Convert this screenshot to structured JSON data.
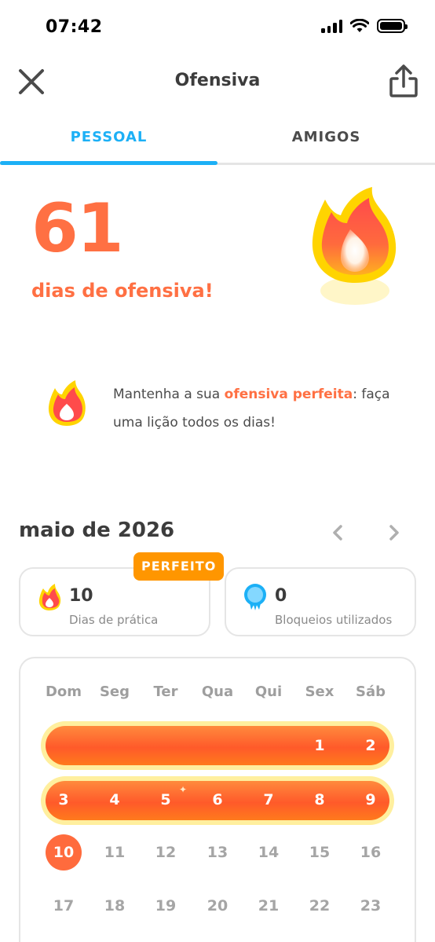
{
  "status_bar": {
    "time": "07:42"
  },
  "header": {
    "title": "Ofensiva",
    "close_icon": "close-icon",
    "share_icon": "share-icon"
  },
  "tabs": [
    {
      "label": "PESSOAL",
      "active": true
    },
    {
      "label": "AMIGOS",
      "active": false
    }
  ],
  "streak": {
    "days": "61",
    "caption": "dias de ofensiva!"
  },
  "tip": {
    "text_before": "Mantenha a sua ",
    "highlight": "ofensiva perfeita",
    "text_after": ": faça uma lição todos os dias!"
  },
  "month": {
    "title": "maio de 2026"
  },
  "stats": {
    "badge": "PERFEITO",
    "practice": {
      "value": "10",
      "label": "Dias de prática",
      "icon": "flame-icon"
    },
    "freezes": {
      "value": "0",
      "label": "Bloqueios utilizados",
      "icon": "streak-freeze-icon"
    }
  },
  "calendar": {
    "weekdays": [
      "Dom",
      "Seg",
      "Ter",
      "Qua",
      "Qui",
      "Sex",
      "Sáb"
    ],
    "week1": [
      "1",
      "2"
    ],
    "week2": [
      "3",
      "4",
      "5",
      "6",
      "7",
      "8",
      "9"
    ],
    "today": "10",
    "week3_rest": [
      "11",
      "12",
      "13",
      "14",
      "15",
      "16"
    ],
    "week4": [
      "17",
      "18",
      "19",
      "20",
      "21",
      "22",
      "23"
    ]
  },
  "colors": {
    "accent_blue": "#1cb0f6",
    "streak_orange": "#ff7043",
    "badge_orange": "#ff9600"
  }
}
